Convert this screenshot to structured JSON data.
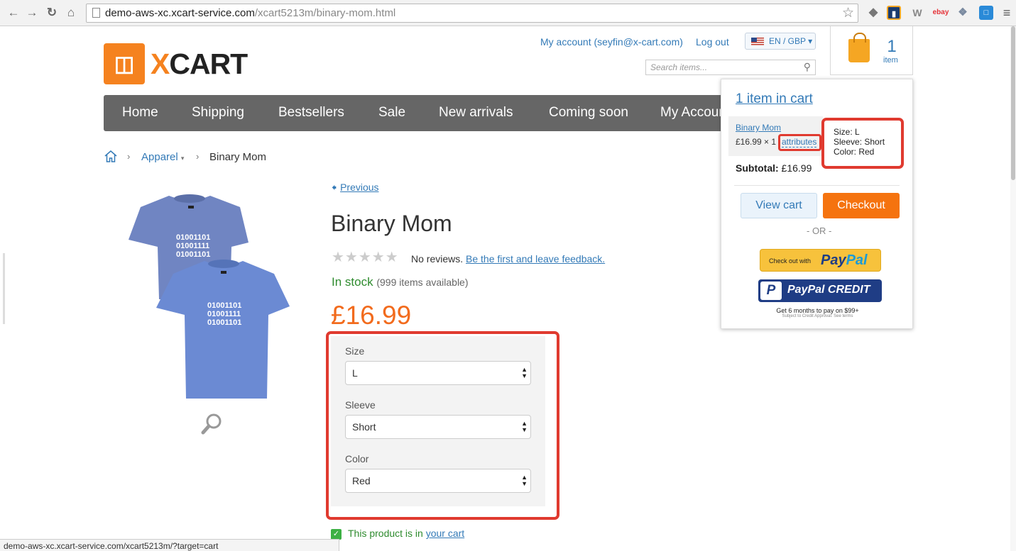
{
  "browser": {
    "url_host": "demo-aws-xc.xcart-service.com",
    "url_path": "/xcart5213m/binary-mom.html",
    "status_url": "demo-aws-xc.xcart-service.com/xcart5213m/?target=cart"
  },
  "header": {
    "logo_text": "XCART",
    "account_link": "My account (seyfin@x-cart.com)",
    "logout_link": "Log out",
    "language": "EN / GBP",
    "search_placeholder": "Search items...",
    "cart_count": "1",
    "cart_unit": "item"
  },
  "menu": [
    "Home",
    "Shipping",
    "Bestsellers",
    "Sale",
    "New arrivals",
    "Coming soon",
    "My Account"
  ],
  "breadcrumb": {
    "category": "Apparel",
    "current": "Binary Mom"
  },
  "product": {
    "previous": "Previous",
    "title": "Binary Mom",
    "no_reviews": "No reviews.",
    "first_feedback": "Be the first and leave feedback.",
    "stock": "In stock",
    "stock_count": "(999 items available)",
    "price": "£16.99",
    "tshirt_print": [
      "01001101",
      "01001111",
      "01001101"
    ],
    "attributes": [
      {
        "label": "Size",
        "value": "L"
      },
      {
        "label": "Sleeve",
        "value": "Short"
      },
      {
        "label": "Color",
        "value": "Red"
      }
    ],
    "in_cart_text": "This product is in",
    "in_cart_link": "your cart"
  },
  "minicart": {
    "heading": "1 item in cart",
    "item_name": "Binary Mom",
    "item_qty": "£16.99 × 1",
    "attributes_link": "attributes",
    "tooltip": [
      "Size: L",
      "Sleeve: Short",
      "Color: Red"
    ],
    "subtotal_label": "Subtotal:",
    "subtotal_value": "£16.99",
    "view_cart": "View cart",
    "checkout": "Checkout",
    "or": "- OR -",
    "paypal_small": "Check out with",
    "paypal_pay": "Pay",
    "paypal_pal": "Pal",
    "paypal_credit": "PayPal CREDIT",
    "paypal_credit_icon": "P",
    "credit_note": "Get 6 months to pay on $99+",
    "credit_sub": "Subject to Credit Approval. See terms"
  },
  "colors": {
    "accent": "#f5821f",
    "link": "#337ab7",
    "stock_green": "#2e8b2e",
    "price": "#f26b1d",
    "highlight": "#e03a2f",
    "shirt": "#6d86c6"
  }
}
